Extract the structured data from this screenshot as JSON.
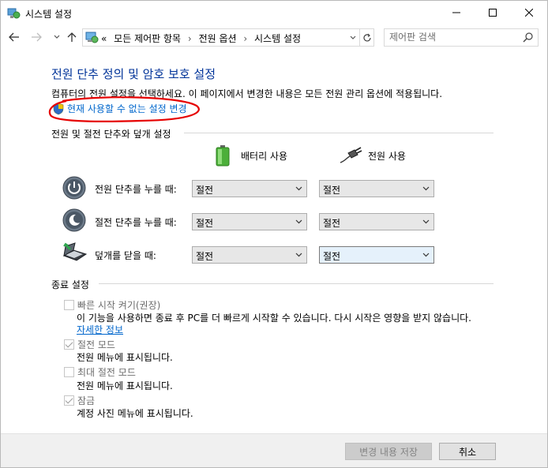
{
  "window": {
    "title": "시스템 설정"
  },
  "nav": {
    "breadcrumbs": [
      "«",
      "모든 제어판 항목",
      "전원 옵션",
      "시스템 설정"
    ],
    "search_placeholder": "제어판 검색"
  },
  "main": {
    "title": "전원 단추 정의 및 암호 보호 설정",
    "subtitle": "컴퓨터의 전원 설정을 선택하세요. 이 페이지에서 변경한 내용은 모든 전원 관리 옵션에 적용됩니다.",
    "change_link": "현재 사용할 수 없는 설정 변경"
  },
  "power": {
    "group_label": "전원 및 절전 단추와 덮개 설정",
    "battery_header": "배터리 사용",
    "plugged_header": "전원 사용",
    "rows": [
      {
        "label": "전원 단추를 누를 때:",
        "battery": "절전",
        "plugged": "절전",
        "icon": "power-button-icon"
      },
      {
        "label": "절전 단추를 누를 때:",
        "battery": "절전",
        "plugged": "절전",
        "icon": "sleep-button-icon"
      },
      {
        "label": "덮개를 닫을 때:",
        "battery": "절전",
        "plugged": "절전",
        "icon": "laptop-lid-icon"
      }
    ]
  },
  "shutdown": {
    "group_label": "종료 설정",
    "items": [
      {
        "label": "빠른 시작 켜기(권장)",
        "checked": false,
        "desc": "이 기능을 사용하면 종료 후 PC를 더 빠르게 시작할 수 있습니다. 다시 시작은 영향을 받지 않습니다.",
        "link": "자세한 정보"
      },
      {
        "label": "절전 모드",
        "checked": true,
        "desc": "전원 메뉴에 표시됩니다."
      },
      {
        "label": "최대 절전 모드",
        "checked": false,
        "desc": "전원 메뉴에 표시됩니다."
      },
      {
        "label": "잠금",
        "checked": true,
        "desc": "계정 사진 메뉴에 표시됩니다."
      }
    ]
  },
  "footer": {
    "save_label": "변경 내용 저장",
    "cancel_label": "취소"
  },
  "colors": {
    "title_blue": "#003399",
    "link_blue": "#0066cc",
    "annotation_red": "#e60000"
  }
}
